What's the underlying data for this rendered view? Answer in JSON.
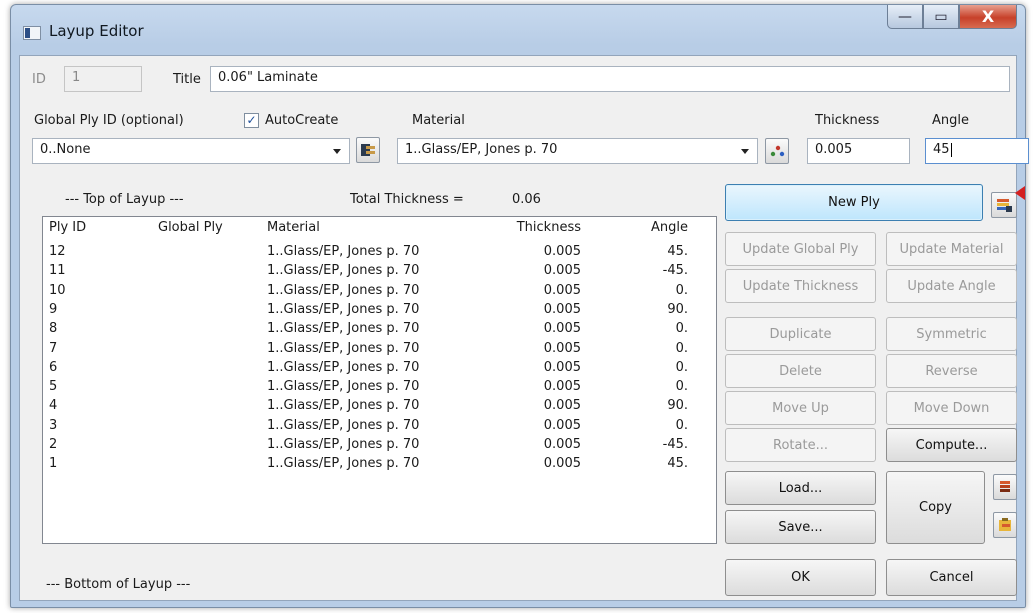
{
  "window": {
    "title": "Layup Editor",
    "minimize": "—",
    "maximize": "▭",
    "close": "X"
  },
  "header": {
    "id_label": "ID",
    "id_value": "1",
    "title_label": "Title",
    "title_value": "0.06\" Laminate"
  },
  "global_ply": {
    "label": "Global Ply ID (optional)",
    "value": "0..None"
  },
  "autocreate": {
    "label": "AutoCreate",
    "checked": true,
    "mark": "✓"
  },
  "material": {
    "label": "Material",
    "value": "1..Glass/EP, Jones p. 70"
  },
  "thickness": {
    "label": "Thickness",
    "value": "0.005"
  },
  "angle": {
    "label": "Angle",
    "value": "45"
  },
  "layup": {
    "top_label": "--- Top of Layup ---",
    "bottom_label": "--- Bottom of Layup ---",
    "total_thickness_label": "Total Thickness =",
    "total_thickness_value": "0.06"
  },
  "table": {
    "columns": [
      "Ply ID",
      "Global Ply",
      "Material",
      "Thickness",
      "Angle"
    ],
    "rows": [
      [
        "12",
        "",
        "1..Glass/EP, Jones p. 70",
        "0.005",
        "45."
      ],
      [
        "11",
        "",
        "1..Glass/EP, Jones p. 70",
        "0.005",
        "-45."
      ],
      [
        "10",
        "",
        "1..Glass/EP, Jones p. 70",
        "0.005",
        "0."
      ],
      [
        "9",
        "",
        "1..Glass/EP, Jones p. 70",
        "0.005",
        "90."
      ],
      [
        "8",
        "",
        "1..Glass/EP, Jones p. 70",
        "0.005",
        "0."
      ],
      [
        "7",
        "",
        "1..Glass/EP, Jones p. 70",
        "0.005",
        "0."
      ],
      [
        "6",
        "",
        "1..Glass/EP, Jones p. 70",
        "0.005",
        "0."
      ],
      [
        "5",
        "",
        "1..Glass/EP, Jones p. 70",
        "0.005",
        "0."
      ],
      [
        "4",
        "",
        "1..Glass/EP, Jones p. 70",
        "0.005",
        "90."
      ],
      [
        "3",
        "",
        "1..Glass/EP, Jones p. 70",
        "0.005",
        "0."
      ],
      [
        "2",
        "",
        "1..Glass/EP, Jones p. 70",
        "0.005",
        "-45."
      ],
      [
        "1",
        "",
        "1..Glass/EP, Jones p. 70",
        "0.005",
        "45."
      ]
    ]
  },
  "buttons": {
    "new_ply": "New Ply",
    "update_global_ply": "Update Global Ply",
    "update_material": "Update Material",
    "update_thickness": "Update Thickness",
    "update_angle": "Update Angle",
    "duplicate": "Duplicate",
    "symmetric": "Symmetric",
    "delete": "Delete",
    "reverse": "Reverse",
    "move_up": "Move Up",
    "move_down": "Move Down",
    "rotate": "Rotate...",
    "compute": "Compute...",
    "load": "Load...",
    "save": "Save...",
    "copy": "Copy",
    "ok": "OK",
    "cancel": "Cancel"
  },
  "icons": {
    "global_ply_picker": "layer-picker-icon",
    "material_picker": "material-picker-icon",
    "new_ply_extra": "ply-stack-icon",
    "copy_to_clipboard": "copy-icon",
    "paste_from_clipboard": "paste-icon",
    "window_app": "app-icon"
  },
  "colors": {
    "titlebar": "#b8cde6",
    "client_bg": "#f0f0f0",
    "primary_button": "#bee6fd",
    "arrow_annotation": "#d42020"
  }
}
